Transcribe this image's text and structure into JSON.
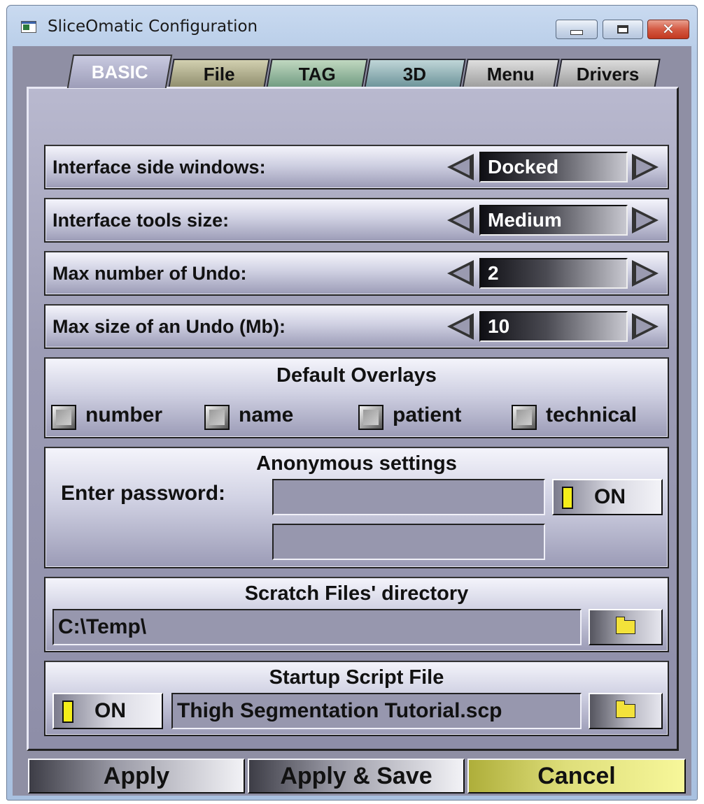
{
  "window": {
    "title": "SliceOmatic Configuration",
    "minimize_icon": "minimize-icon",
    "maximize_icon": "maximize-icon",
    "close_icon": "close-icon",
    "close_glyph": "✕"
  },
  "tabs": [
    {
      "label": "BASIC",
      "active": true
    },
    {
      "label": "File"
    },
    {
      "label": "TAG"
    },
    {
      "label": "3D"
    },
    {
      "label": "Menu"
    },
    {
      "label": "Drivers"
    }
  ],
  "settings": {
    "side_windows": {
      "label": "Interface side windows:",
      "value": "Docked"
    },
    "tools_size": {
      "label": "Interface tools size:",
      "value": "Medium"
    },
    "max_undo": {
      "label": "Max number of Undo:",
      "value": "2"
    },
    "undo_size": {
      "label": "Max size of an Undo (Mb):",
      "value": "10"
    }
  },
  "overlays": {
    "title": "Default Overlays",
    "items": [
      {
        "label": "number",
        "checked": false
      },
      {
        "label": "name",
        "checked": false
      },
      {
        "label": "patient",
        "checked": false
      },
      {
        "label": "technical",
        "checked": false
      }
    ]
  },
  "anonymous": {
    "title": "Anonymous settings",
    "password_label": "Enter password:",
    "password_value": "",
    "confirm_value": "",
    "toggle_label": "ON"
  },
  "scratch": {
    "title": "Scratch Files' directory",
    "path": "C:\\Temp\\"
  },
  "startup": {
    "title": "Startup Script File",
    "toggle_label": "ON",
    "file": "Thigh Segmentation Tutorial.scp"
  },
  "buttons": {
    "apply": "Apply",
    "apply_save": "Apply & Save",
    "cancel": "Cancel"
  },
  "colors": {
    "lamp_on": "#f4ee1a",
    "cancel_accent": "#f7f79a",
    "panel": "#9c9cb5"
  }
}
